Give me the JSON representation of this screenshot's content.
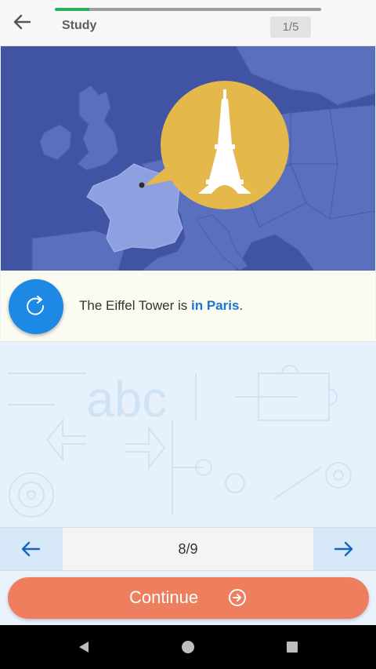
{
  "header": {
    "title": "Study",
    "count": "1/5",
    "progress": 0.13
  },
  "fact": {
    "prefix": "The Eiffel Tower is ",
    "highlight": "in Paris",
    "suffix": "."
  },
  "pager": {
    "label": "8/9"
  },
  "continue": {
    "label": "Continue"
  },
  "icons": {
    "back": "arrow-left-icon",
    "replay": "refresh-icon",
    "prev": "arrow-left-icon",
    "next": "arrow-right-icon",
    "continue": "circle-arrow-right-icon",
    "landmark": "eiffel-tower-icon"
  },
  "colors": {
    "map_sea": "#4154a3",
    "map_land": "#5b6fbf",
    "france": "#8fa0e0",
    "bubble": "#e4b84a",
    "accent": "#1e88e5",
    "continue": "#ee7e5e",
    "progress": "#27ae60"
  }
}
